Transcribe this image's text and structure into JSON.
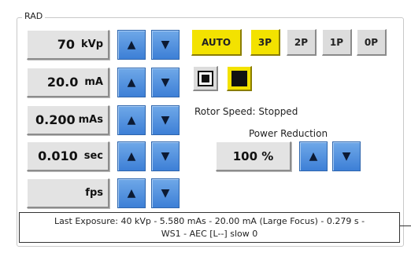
{
  "panel": {
    "title": "RAD"
  },
  "fields": [
    {
      "value": "70",
      "unit": "kVp"
    },
    {
      "value": "20.0",
      "unit": "mA"
    },
    {
      "value": "0.200",
      "unit": "mAs"
    },
    {
      "value": "0.010",
      "unit": "sec"
    },
    {
      "value": "",
      "unit": "fps"
    }
  ],
  "arrows": {
    "up": "▲",
    "down": "▼"
  },
  "modes": {
    "auto": "AUTO",
    "p3": "3P",
    "p2": "2P",
    "p1": "1P",
    "p0": "0P",
    "active": [
      "AUTO",
      "3P"
    ],
    "active_color": "#f3e200"
  },
  "focus": {
    "small_icon": "small-focus-icon",
    "large_icon": "large-focus-icon",
    "selected": "large"
  },
  "rotor": {
    "text": "Rotor Speed: Stopped"
  },
  "power_reduction": {
    "label": "Power Reduction",
    "value": "100 %"
  },
  "status": {
    "line1": "Last Exposure:  40 kVp -   5.580 mAs -   20.00 mA (Large Focus) -  0.279 s -",
    "line2": "WS1 - AEC [L--]  slow   0"
  },
  "colors": {
    "arrow_blue": "#3d7fd6",
    "button_gray": "#dcdcdc"
  }
}
